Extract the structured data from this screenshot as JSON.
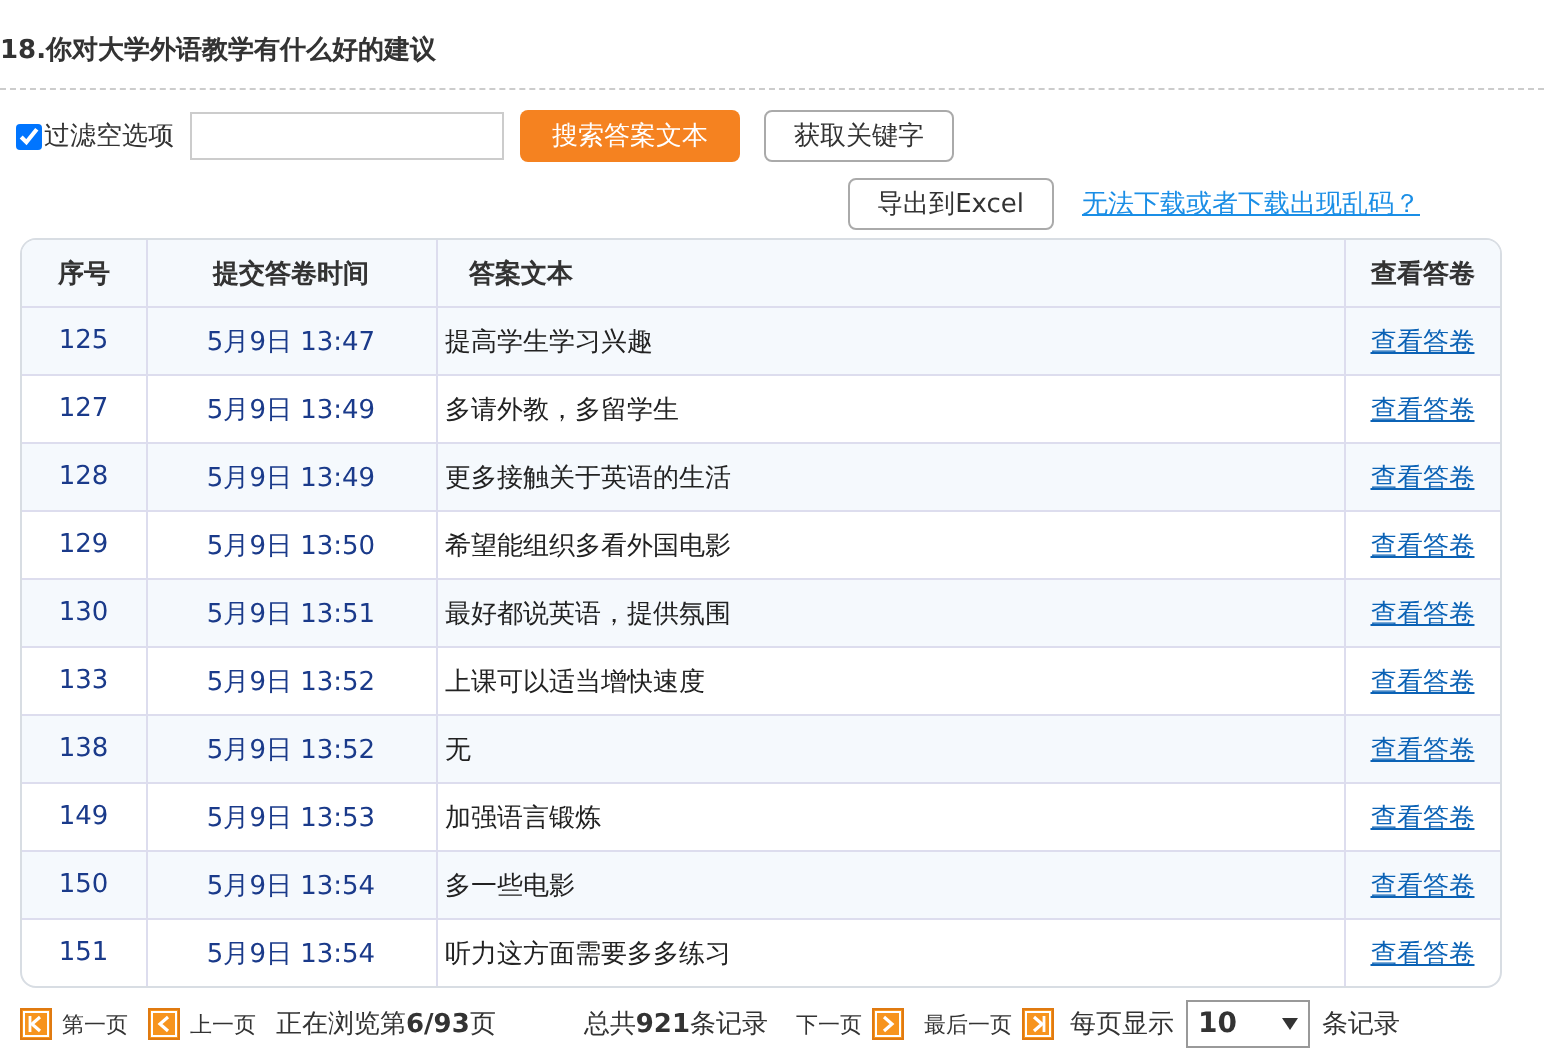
{
  "question": {
    "title": "18.你对大学外语教学有什么好的建议"
  },
  "toolbar": {
    "filter_checkbox": {
      "label": "过滤空选项",
      "checked": true
    },
    "search_button": "搜索答案文本",
    "keyword_button": "获取关键字",
    "export_button": "导出到Excel",
    "help_link": "无法下载或者下载出现乱码？"
  },
  "table": {
    "columns": [
      "序号",
      "提交答卷时间",
      "答案文本",
      "查看答卷"
    ],
    "rows": [
      {
        "id": "125",
        "time": "5月9日 13:47",
        "answer": "提高学生学习兴趣",
        "link": "查看答卷"
      },
      {
        "id": "127",
        "time": "5月9日 13:49",
        "answer": "多请外教，多留学生",
        "link": "查看答卷"
      },
      {
        "id": "128",
        "time": "5月9日 13:49",
        "answer": "更多接触关于英语的生活",
        "link": "查看答卷"
      },
      {
        "id": "129",
        "time": "5月9日 13:50",
        "answer": "希望能组织多看外国电影",
        "link": "查看答卷"
      },
      {
        "id": "130",
        "time": "5月9日 13:51",
        "answer": "最好都说英语，提供氛围",
        "link": "查看答卷"
      },
      {
        "id": "133",
        "time": "5月9日 13:52",
        "answer": "上课可以适当增快速度",
        "link": "查看答卷"
      },
      {
        "id": "138",
        "time": "5月9日 13:52",
        "answer": "无",
        "link": "查看答卷"
      },
      {
        "id": "149",
        "time": "5月9日 13:53",
        "answer": "加强语言锻炼",
        "link": "查看答卷"
      },
      {
        "id": "150",
        "time": "5月9日 13:54",
        "answer": "多一些电影",
        "link": "查看答卷"
      },
      {
        "id": "151",
        "time": "5月9日 13:54",
        "answer": "听力这方面需要多多练习",
        "link": "查看答卷"
      }
    ]
  },
  "pagination": {
    "first": "第一页",
    "prev": "上一页",
    "status": "正在浏览第**6/93**页",
    "total": "总共**921**条记录",
    "next": "下一页",
    "last": "最后一页",
    "per_page_label": "每页显示",
    "per_page": "10",
    "per_page_suffix": "条记录"
  }
}
